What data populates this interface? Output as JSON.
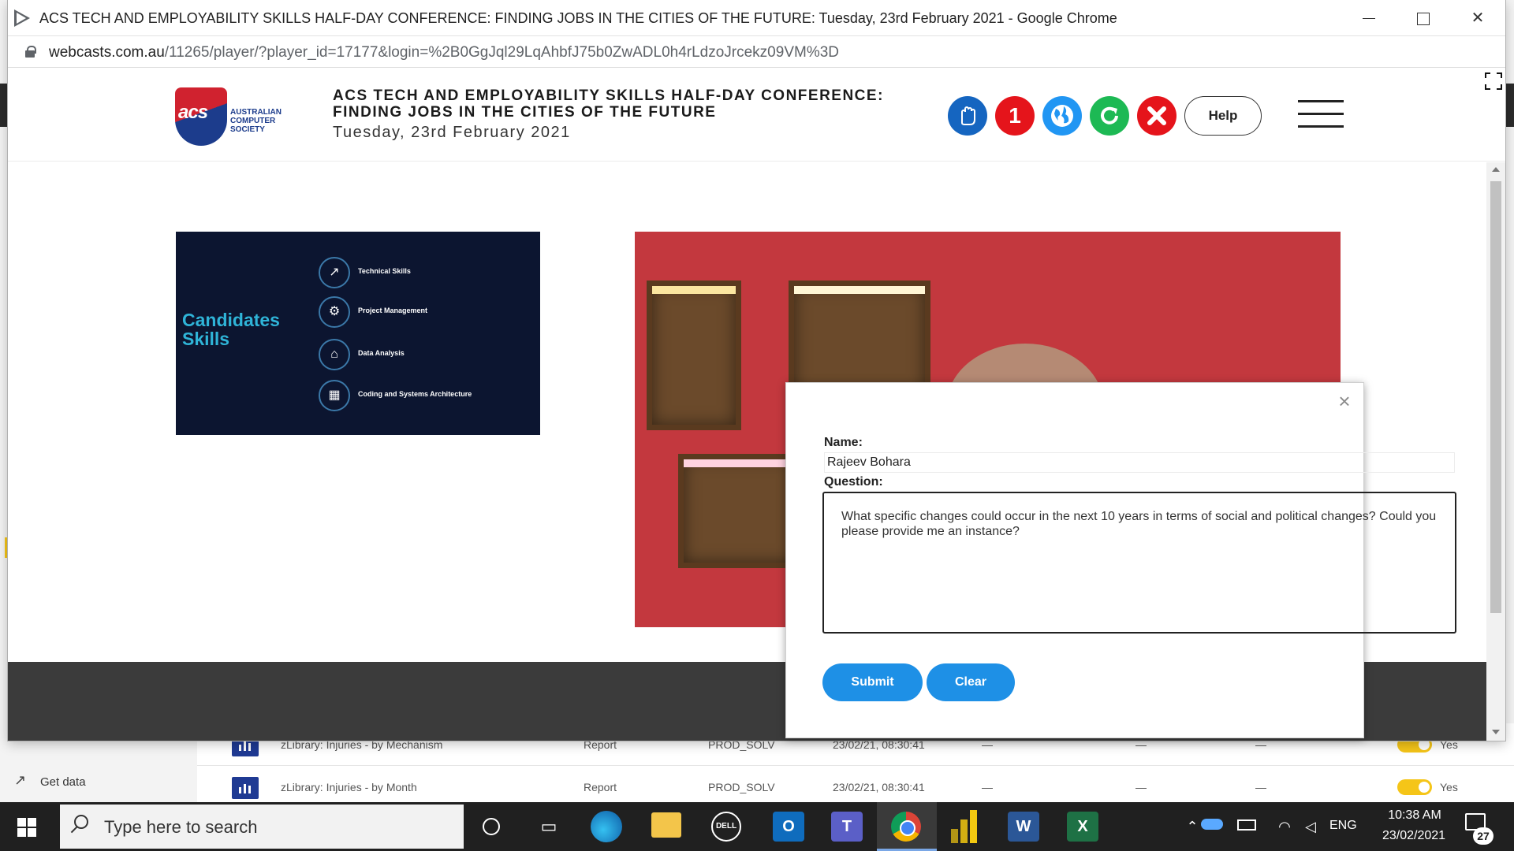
{
  "window": {
    "title": "ACS TECH AND EMPLOYABILITY SKILLS HALF-DAY CONFERENCE: FINDING JOBS IN THE CITIES OF THE FUTURE: Tuesday, 23rd February 2021 - Google Chrome",
    "minimize": "",
    "maximize": "",
    "close": "✕"
  },
  "address": {
    "host": "webcasts.com.au",
    "path": "/11265/player/?player_id=17177&login=%2B0GgJql29LqAhbfJ75b0ZwADL0h4rLdzoJrcekz09VM%3D"
  },
  "header": {
    "logo_text": "acs",
    "logo_org_line1": "AUSTRALIAN",
    "logo_org_line2": "COMPUTER",
    "logo_org_line3": "SOCIETY",
    "title_line1": "ACS TECH AND EMPLOYABILITY SKILLS HALF-DAY CONFERENCE:",
    "title_line2": "FINDING JOBS IN THE CITIES OF THE FUTURE",
    "date": "Tuesday, 23rd February 2021",
    "notification_count": "1",
    "help_label": "Help"
  },
  "slide": {
    "heading_line1": "Candidates",
    "heading_line2": "Skills",
    "items": [
      {
        "label": "Technical Skills"
      },
      {
        "label": "Project Management"
      },
      {
        "label": "Data Analysis"
      },
      {
        "label": "Coding and Systems Architecture"
      }
    ]
  },
  "dialog": {
    "close": "×",
    "name_label": "Name:",
    "name_value": "Rajeev Bohara",
    "question_label": "Question:",
    "question_value": "What specific changes could occur in the next 10 years in terms of social and political changes? Could you please provide me an instance?",
    "submit_label": "Submit",
    "clear_label": "Clear"
  },
  "background_app": {
    "get_data_label": "Get data",
    "rows": [
      {
        "name": "zLibrary: Injuries - by Mechanism",
        "type": "Report",
        "owner": "PROD_SOLV",
        "refreshed": "23/02/21, 08:30:41",
        "c1": "—",
        "c2": "—",
        "c3": "—",
        "flag": "Yes"
      },
      {
        "name": "zLibrary: Injuries - by Month",
        "type": "Report",
        "owner": "PROD_SOLV",
        "refreshed": "23/02/21, 08:30:41",
        "c1": "—",
        "c2": "—",
        "c3": "—",
        "flag": "Yes"
      }
    ]
  },
  "taskbar": {
    "search_placeholder": "Type here to search",
    "dell_label": "DELL",
    "outlook_letter": "O",
    "teams_letter": "T",
    "word_letter": "W",
    "excel_letter": "X",
    "language": "ENG",
    "time": "10:38 AM",
    "date": "23/02/2021",
    "notification_count": "27"
  },
  "colors": {
    "accent_blue": "#1e90e6",
    "acs_red": "#d0222f",
    "acs_blue": "#1c3c8c",
    "taskbar": "#202020"
  }
}
